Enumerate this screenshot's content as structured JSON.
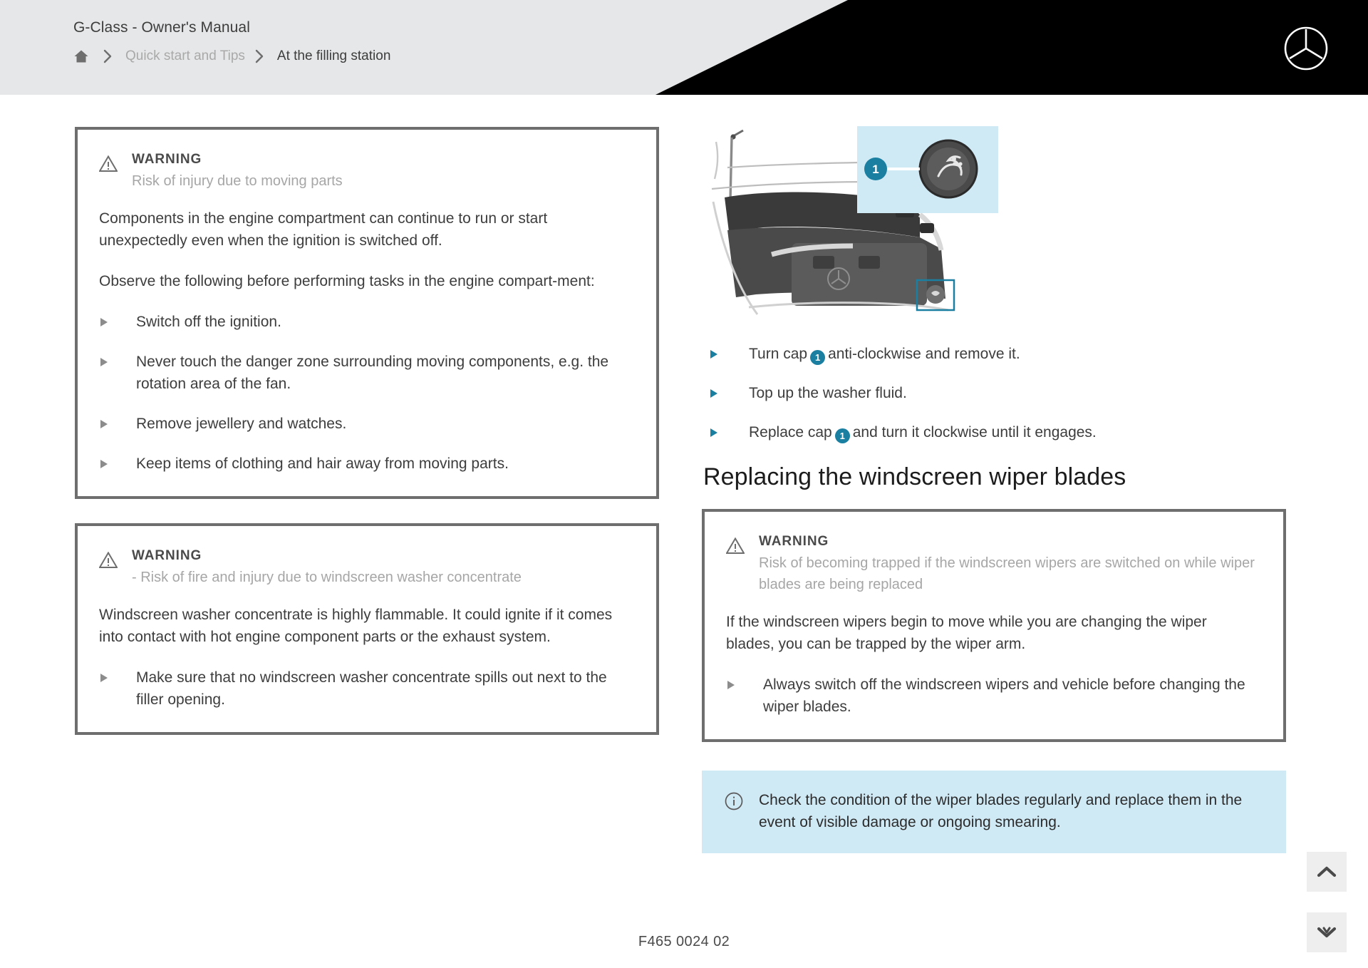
{
  "header": {
    "manual_title": "G-Class - Owner's Manual",
    "breadcrumb": {
      "home_icon": "home-icon",
      "separator_icon": "chevron-right-icon",
      "parent": "Quick start and Tips",
      "current": "At the filling station"
    },
    "brand_logo": "mercedes-star-icon"
  },
  "left_column": {
    "warning_moving_parts": {
      "icon": "warning-triangle-icon",
      "title": "WARNING",
      "subtitle": "Risk of injury due to moving parts",
      "paragraphs": [
        "Components in the engine compartment can continue to run or start unexpectedly even when the ignition is switched off.",
        "Observe the following before performing tasks in the engine compart-ment:"
      ],
      "bullets": [
        "Switch off the ignition.",
        "Never touch the danger zone surrounding moving components, e.g. the rotation area of the fan.",
        "Remove jewellery and watches.",
        "Keep items of clothing and hair away from moving parts."
      ]
    },
    "warning_washer_concentrate": {
      "icon": "warning-triangle-icon",
      "title": "WARNING",
      "subtitle": "- Risk of fire and injury due to windscreen washer concentrate",
      "paragraphs": [
        "Windscreen washer concentrate is highly flammable. It could ignite if it comes into contact with hot engine component parts or the exhaust system."
      ],
      "bullets": [
        "Make sure that no windscreen washer concentrate spills out next to the filler opening."
      ]
    }
  },
  "right_column": {
    "figure": {
      "name": "engine-compartment-washer-fluid-diagram",
      "callout_number": "1",
      "callout_label": "windscreen-washer-cap-icon"
    },
    "steps": [
      {
        "before": "Turn cap",
        "number": "1",
        "after": "anti-clockwise and remove it."
      },
      {
        "before": "Top up the washer fluid.",
        "number": "",
        "after": ""
      },
      {
        "before": "Replace cap",
        "number": "1",
        "after": "and turn it clockwise until it engages."
      }
    ],
    "section_heading": "Replacing the windscreen wiper blades",
    "warning_trapped": {
      "icon": "warning-triangle-icon",
      "title": "WARNING",
      "subtitle": "Risk of becoming trapped if the windscreen wipers are switched on while wiper blades are being replaced",
      "paragraphs": [
        "If the windscreen wipers begin to move while you are changing the wiper blades, you can be trapped by the wiper arm."
      ],
      "bullets": [
        "Always switch off the windscreen wipers and vehicle before changing the wiper blades."
      ]
    },
    "info_note": {
      "icon": "info-circle-icon",
      "text": "Check the condition of the wiper blades regularly and replace them in the event of visible damage or ongoing smearing."
    }
  },
  "footer": {
    "code": "F465 0024 02"
  },
  "floating_buttons": [
    {
      "name": "scroll-to-top-button",
      "icon": "chevron-up-icon"
    },
    {
      "name": "scroll-to-bottom-button",
      "icon": "chevron-down-icon"
    }
  ],
  "colors": {
    "header_background": "#e6e7e8",
    "header_accent": "#000000",
    "warning_border": "#6e6e6e",
    "note_background": "#cfe9f5",
    "callout_blue": "#1a7fa0",
    "step_marker": "#1a7fa0",
    "text_primary": "#3d3d3d",
    "text_muted": "#a6a6a6"
  }
}
